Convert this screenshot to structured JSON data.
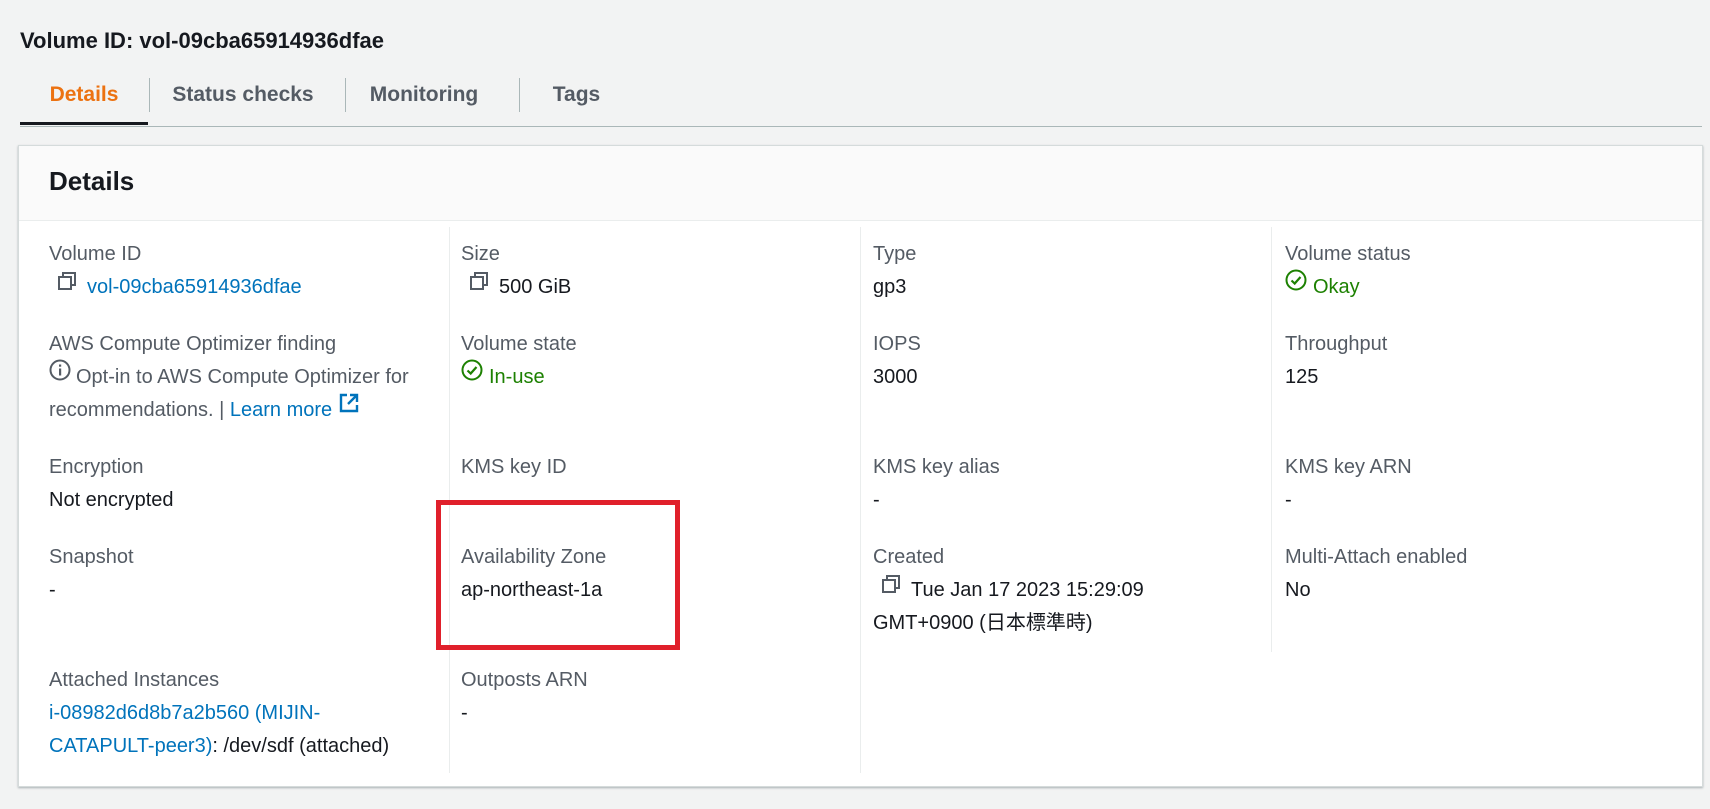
{
  "page": {
    "title": "Volume ID: vol-09cba65914936dfae"
  },
  "tabs": [
    {
      "label": "Details",
      "active": true
    },
    {
      "label": "Status checks",
      "active": false
    },
    {
      "label": "Monitoring",
      "active": false
    },
    {
      "label": "Tags",
      "active": false
    }
  ],
  "panel": {
    "title": "Details"
  },
  "fields": {
    "volume_id": {
      "label": "Volume ID",
      "value": "vol-09cba65914936dfae"
    },
    "size": {
      "label": "Size",
      "value": "500 GiB"
    },
    "type": {
      "label": "Type",
      "value": "gp3"
    },
    "volume_status": {
      "label": "Volume status",
      "value": "Okay"
    },
    "optimizer": {
      "label": "AWS Compute Optimizer finding",
      "text": "Opt-in to AWS Compute Optimizer for recommendations.",
      "separator": "|",
      "link": "Learn more"
    },
    "volume_state": {
      "label": "Volume state",
      "value": "In-use"
    },
    "iops": {
      "label": "IOPS",
      "value": "3000"
    },
    "throughput": {
      "label": "Throughput",
      "value": "125"
    },
    "encryption": {
      "label": "Encryption",
      "value": "Not encrypted"
    },
    "kms_key_id": {
      "label": "KMS key ID",
      "value": ""
    },
    "kms_key_alias": {
      "label": "KMS key alias",
      "value": "-"
    },
    "kms_key_arn": {
      "label": "KMS key ARN",
      "value": "-"
    },
    "snapshot": {
      "label": "Snapshot",
      "value": "-"
    },
    "availability_zone": {
      "label": "Availability Zone",
      "value": "ap-northeast-1a"
    },
    "created": {
      "label": "Created",
      "line1": "Tue Jan 17 2023 15:29:09",
      "line2": "GMT+0900 (日本標準時)"
    },
    "multi_attach": {
      "label": "Multi-Attach enabled",
      "value": "No"
    },
    "attached_instances": {
      "label": "Attached Instances",
      "link_line1": "i-08982d6d8b7a2b560 (MIJIN-",
      "link_line2": "CATAPULT-peer3)",
      "suffix": ": /dev/sdf (attached)"
    },
    "outposts_arn": {
      "label": "Outposts ARN",
      "value": "-"
    }
  },
  "icons": {
    "copy": "copy-icon",
    "status_ok": "check-circle-icon",
    "info": "info-icon",
    "external": "external-link-icon"
  },
  "colors": {
    "active_tab": "#ec7211",
    "link": "#0073bb",
    "success": "#1d8102",
    "highlight": "#e0202b"
  }
}
